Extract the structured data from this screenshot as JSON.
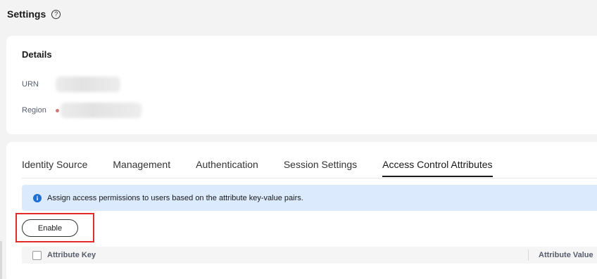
{
  "header": {
    "title": "Settings",
    "help_glyph": "?"
  },
  "details": {
    "title": "Details",
    "urn_label": "URN",
    "region_label": "Region"
  },
  "tabs": [
    {
      "label": "Identity Source"
    },
    {
      "label": "Management"
    },
    {
      "label": "Authentication"
    },
    {
      "label": "Session Settings"
    },
    {
      "label": "Access Control Attributes",
      "active": true
    }
  ],
  "notice": {
    "icon_glyph": "i",
    "text": "Assign access permissions to users based on the attribute key-value pairs."
  },
  "actions": {
    "enable_label": "Enable"
  },
  "table": {
    "columns": [
      "Attribute Key",
      "Attribute Value"
    ]
  },
  "colors": {
    "accent_info": "#1f6fd1",
    "notice_bg": "#dbeafd",
    "highlight_border": "#e12b2b"
  }
}
